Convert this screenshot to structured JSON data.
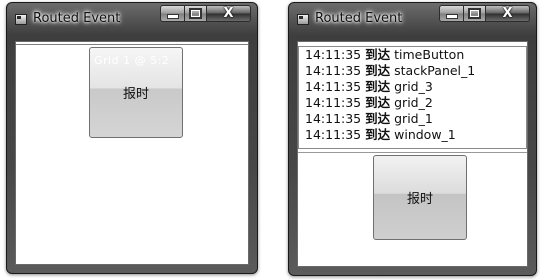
{
  "window_left": {
    "title": "Routed Event",
    "button_label": "报时",
    "button_overlay_text": "Grid 1 @ 5:2"
  },
  "window_right": {
    "title": "Routed Event",
    "button_label": "报时",
    "log_entries": [
      {
        "time": "14:11:35",
        "verb": "到达",
        "target": "timeButton"
      },
      {
        "time": "14:11:35",
        "verb": "到达",
        "target": "stackPanel_1"
      },
      {
        "time": "14:11:35",
        "verb": "到达",
        "target": "grid_3"
      },
      {
        "time": "14:11:35",
        "verb": "到达",
        "target": "grid_2"
      },
      {
        "time": "14:11:35",
        "verb": "到达",
        "target": "grid_1"
      },
      {
        "time": "14:11:35",
        "verb": "到达",
        "target": "window_1"
      }
    ]
  },
  "caption_buttons": {
    "close_glyph": "X"
  },
  "icons": [
    "window-icon",
    "minimize-icon",
    "maximize-icon",
    "close-icon"
  ]
}
